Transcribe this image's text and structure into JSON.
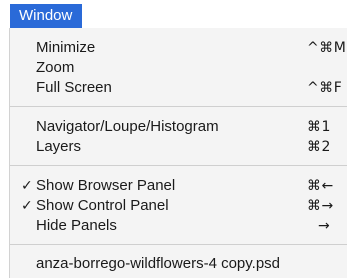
{
  "menubar": {
    "active_menu": "Window"
  },
  "menu": {
    "groups": [
      [
        {
          "label": "Minimize",
          "shortcut": "^⌘M"
        },
        {
          "label": "Zoom",
          "shortcut": ""
        },
        {
          "label": "Full Screen",
          "shortcut": "^⌘F"
        }
      ],
      [
        {
          "label": "Navigator/Loupe/Histogram",
          "shortcut": "⌘1"
        },
        {
          "label": "Layers",
          "shortcut": "⌘2"
        }
      ],
      [
        {
          "label": "Show Browser Panel",
          "shortcut": "⌘←",
          "checked": true
        },
        {
          "label": "Show Control Panel",
          "shortcut": "⌘→",
          "checked": true
        },
        {
          "label": "Hide Panels",
          "shortcut": "→"
        }
      ],
      [
        {
          "label": "anza-borrego-wildflowers-4 copy.psd",
          "shortcut": ""
        }
      ]
    ],
    "check_glyph": "✓"
  },
  "colors": {
    "menu_highlight": "#2a6ad8",
    "menu_bg": "#f4f4f4"
  }
}
